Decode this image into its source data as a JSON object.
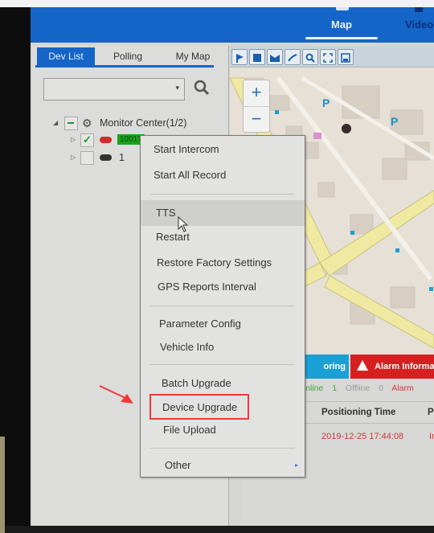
{
  "header": {
    "nav": [
      {
        "label": "Map",
        "active": true,
        "icon": "monitor-icon"
      },
      {
        "label": "Video",
        "active": false,
        "icon": "video-icon"
      }
    ]
  },
  "left_panel": {
    "tabs": [
      {
        "label": "Dev List",
        "active": true
      },
      {
        "label": "Polling",
        "active": false
      },
      {
        "label": "My Map",
        "active": false
      }
    ],
    "search": {
      "value": "",
      "placeholder": ""
    },
    "tree": {
      "root": {
        "label": "Monitor Center(1/2)",
        "state": "partial"
      },
      "devices": [
        {
          "label": "1001?",
          "checked": true,
          "status_color": "#d42a2a",
          "online": true
        },
        {
          "label": "1",
          "checked": false,
          "status_color": "#333333",
          "online": false
        }
      ]
    }
  },
  "map": {
    "toolbar": [
      "flag-icon",
      "square-icon",
      "polygon-icon",
      "line-icon",
      "search-icon",
      "fullscreen-icon",
      "save-icon"
    ],
    "zoom_in": "+",
    "zoom_out": "−",
    "markers": [
      "P",
      "P"
    ]
  },
  "bottom_panel": {
    "tabs": [
      {
        "label": "Monitoring",
        "visible_label": "oring",
        "color": "#1aa0d4"
      },
      {
        "label": "Alarm Information",
        "visible_label": "Alarm Informa",
        "color": "#d62020"
      }
    ],
    "stats": {
      "online_label": "Online",
      "online_value": "1",
      "offline_label": "Offline",
      "offline_value": "0",
      "alarm_label": "Alarm"
    },
    "columns": [
      "Positioning Time",
      "Po"
    ],
    "rows": [
      {
        "time": "2019-12-25 17:44:08",
        "next": "In"
      }
    ]
  },
  "context_menu": {
    "groups": [
      [
        "Start Intercom",
        "Start All Record"
      ],
      [
        "TTS",
        "Restart",
        "Restore Factory Settings",
        "GPS Reports Interval"
      ],
      [
        "Parameter Config",
        "Vehicle Info"
      ],
      [
        "Batch Upgrade",
        "Device Upgrade",
        "File Upload"
      ],
      [
        "Other"
      ]
    ],
    "hovered": "TTS",
    "highlighted": "Device Upgrade",
    "annotation_color": "#ef3a3a"
  }
}
